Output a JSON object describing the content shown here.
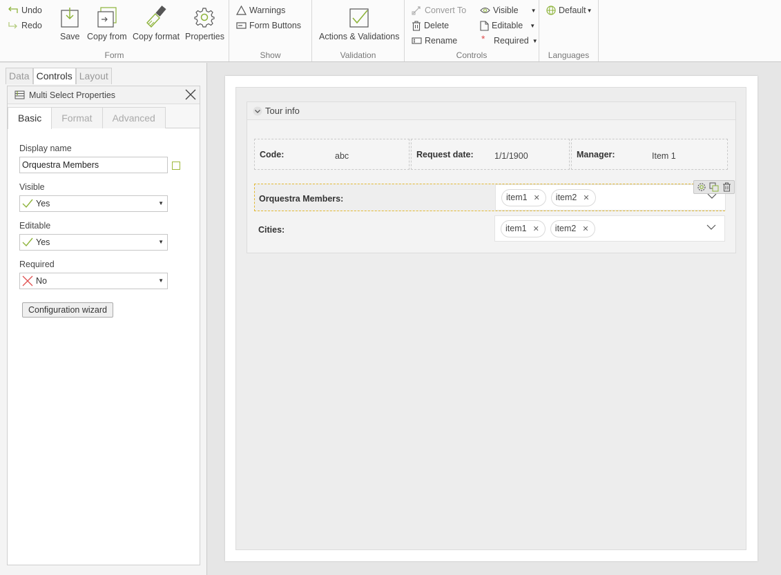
{
  "ribbon": {
    "form": {
      "undo": "Undo",
      "redo": "Redo",
      "save": "Save",
      "copy_from": "Copy from",
      "copy_format": "Copy format",
      "properties": "Properties",
      "group_label": "Form"
    },
    "show": {
      "warnings": "Warnings",
      "form_buttons": "Form Buttons",
      "group_label": "Show"
    },
    "validation": {
      "actions": "Actions & Validations",
      "group_label": "Validation"
    },
    "controls": {
      "convert_to": "Convert To",
      "delete": "Delete",
      "rename": "Rename",
      "visible": "Visible",
      "editable": "Editable",
      "required": "Required",
      "group_label": "Controls"
    },
    "languages": {
      "default": "Default",
      "group_label": "Languages"
    }
  },
  "left_panel": {
    "tabs": [
      "Data",
      "Controls",
      "Layout"
    ],
    "active_tab": "Controls",
    "properties_title": "Multi Select Properties",
    "subtabs": [
      "Basic",
      "Format",
      "Advanced"
    ],
    "display_name_label": "Display name",
    "display_name_value": "Orquestra Members",
    "visible_label": "Visible",
    "visible_value": "Yes",
    "editable_label": "Editable",
    "editable_value": "Yes",
    "required_label": "Required",
    "required_value": "No",
    "wizard_button": "Configuration wizard"
  },
  "form": {
    "section_title": "Tour info",
    "code_label": "Code:",
    "code_value": "abc",
    "request_date_label": "Request date:",
    "request_date_value": "1/1/1900",
    "manager_label": "Manager:",
    "manager_value": "Item 1",
    "orquestra_label": "Orquestra Members:",
    "orquestra_items": [
      "item1",
      "item2"
    ],
    "cities_label": "Cities:",
    "cities_items": [
      "item1",
      "item2"
    ]
  },
  "colors": {
    "accent_green": "#8db33a",
    "selection_yellow": "#e2b830",
    "error_red": "#e05050"
  }
}
